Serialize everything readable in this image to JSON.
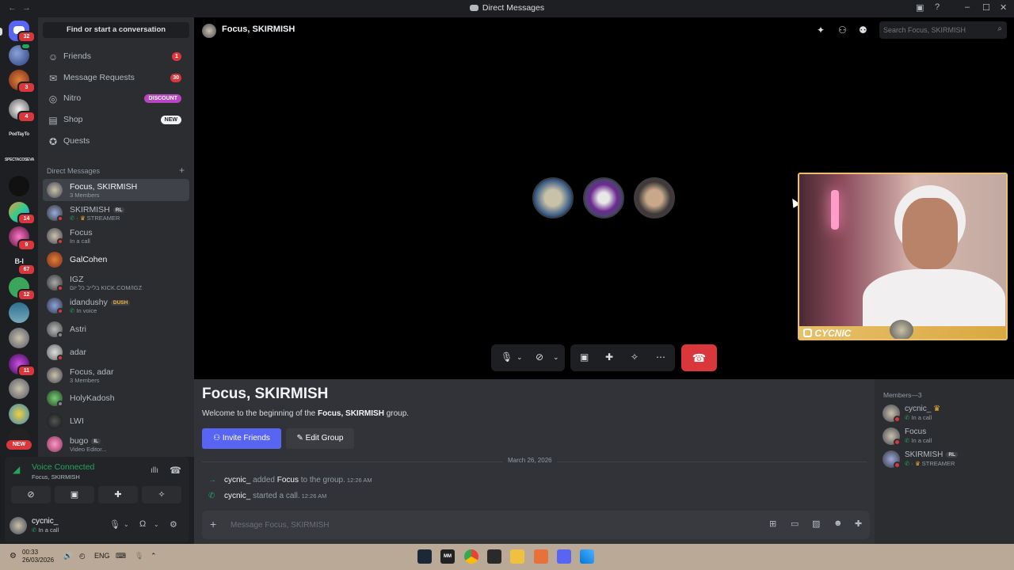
{
  "window": {
    "title": "Direct Messages",
    "back": "←",
    "forward": "→"
  },
  "rail": {
    "badges": [
      "32",
      "4",
      "3",
      "4",
      "14",
      "9",
      "67",
      "12",
      "11"
    ],
    "texts": [
      "PodTayTo",
      "SPECTACOSEVA",
      "B-I"
    ],
    "new_label": "NEW"
  },
  "sidebar": {
    "find_label": "Find or start a conversation",
    "nav": [
      {
        "label": "Friends",
        "icon": "friends-icon",
        "badge": "1"
      },
      {
        "label": "Message Requests",
        "icon": "mail-icon",
        "badge": "30"
      },
      {
        "label": "Nitro",
        "icon": "nitro-icon",
        "pill": "DISCOUNT",
        "pill_color": "#b845c1"
      },
      {
        "label": "Shop",
        "icon": "shop-icon",
        "pill": "NEW",
        "pill_color": "#f2f3f5"
      },
      {
        "label": "Quests",
        "icon": "quests-icon"
      }
    ],
    "dm_header": "Direct Messages",
    "dms": [
      {
        "name": "Focus, SKIRMISH",
        "sub": "3 Members"
      },
      {
        "name": "SKIRMISH",
        "tag": "RL",
        "sub": "STREAMER"
      },
      {
        "name": "Focus",
        "sub": "In a call"
      },
      {
        "name": "GalCohen",
        "sub": ""
      },
      {
        "name": "IGZ",
        "sub": "בלייב כל יום KICK.COM/IGZ"
      },
      {
        "name": "idandushy",
        "tag": "DUSH",
        "sub": "In voice"
      },
      {
        "name": "Astri",
        "sub": ""
      },
      {
        "name": "adar",
        "sub": ""
      },
      {
        "name": "Focus, adar",
        "sub": "3 Members"
      },
      {
        "name": "HolyKadosh",
        "sub": ""
      },
      {
        "name": "LWI",
        "sub": ""
      },
      {
        "name": "bugo",
        "tag": "IL",
        "sub": "Video Editor..."
      }
    ]
  },
  "voice": {
    "title": "Voice Connected",
    "sub": "Focus, SKIRMISH"
  },
  "user": {
    "name": "cycnic_",
    "status": "In a call"
  },
  "call": {
    "header_name": "Focus, SKIRMISH",
    "search_placeholder": "Search Focus, SKIRMISH",
    "video_label": "CYCNIC"
  },
  "chat": {
    "title": "Focus, SKIRMISH",
    "welcome_prefix": "Welcome to the beginning of the ",
    "welcome_bold": "Focus, SKIRMISH",
    "welcome_suffix": " group.",
    "invite_label": "Invite Friends",
    "edit_label": "Edit Group",
    "date_divider": "March 26, 2026",
    "messages": [
      {
        "who": "cycnic_",
        "text": " added ",
        "target": "Focus",
        "rest": " to the group.",
        "time": "12:26 AM"
      },
      {
        "who": "cycnic_",
        "text": " started a call.",
        "target": "",
        "rest": "",
        "time": "12:26 AM"
      }
    ],
    "composer_placeholder": "Message Focus, SKIRMISH"
  },
  "members": {
    "header": "Members—3",
    "list": [
      {
        "name": "cycnic_",
        "sub": "In a call",
        "crown": "♛"
      },
      {
        "name": "Focus",
        "sub": "In a call"
      },
      {
        "name": "SKIRMISH",
        "tag": "RL",
        "sub": "STREAMER"
      }
    ]
  },
  "taskbar": {
    "time": "00:33",
    "date": "26/03/2026",
    "lang": "ENG"
  },
  "colors": {
    "accent": "#5865f2",
    "danger": "#da373c",
    "online": "#23a55a",
    "frame": "#e8c06a"
  }
}
